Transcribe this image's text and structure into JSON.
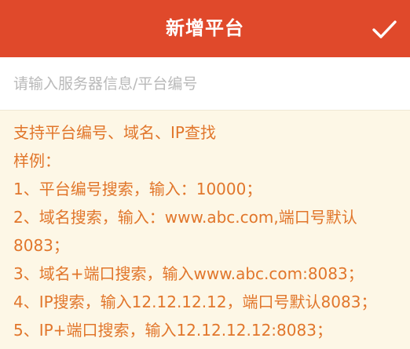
{
  "header": {
    "title": "新增平台",
    "confirm_icon": "checkmark-icon",
    "background_color": "#E0492B",
    "text_color": "#FFFFFF"
  },
  "search": {
    "value": "",
    "placeholder": "请输入服务器信息/平台编号"
  },
  "help": {
    "text_color": "#E1762B",
    "background_color": "#FDF7E6",
    "intro": "支持平台编号、域名、IP查找",
    "examples_label": "样例：",
    "examples": [
      "1、平台编号搜索，输入：10000；",
      "2、域名搜索，输入：www.abc.com,端口号默认8083；",
      "3、域名+端口搜索，输入www.abc.com:8083；",
      "4、IP搜索，输入12.12.12.12，端口号默认8083；",
      "5、IP+端口搜索，输入12.12.12.12:8083；"
    ]
  }
}
